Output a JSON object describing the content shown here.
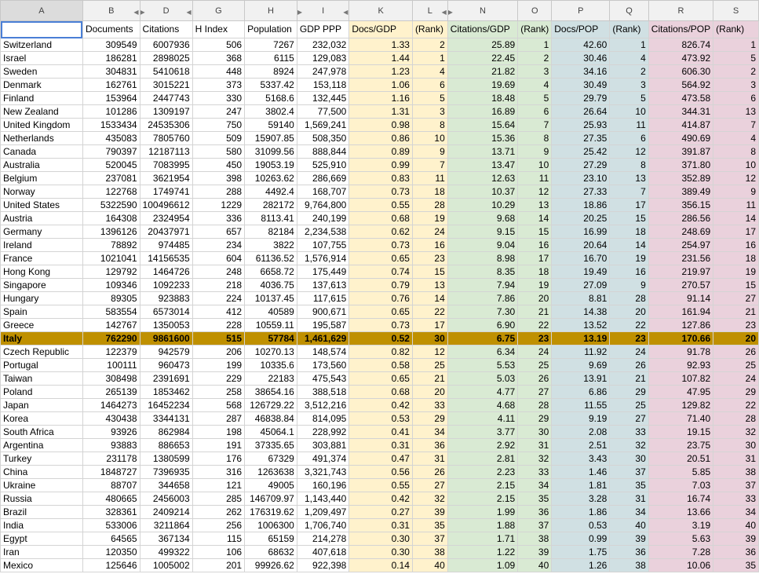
{
  "columns": [
    "A",
    "B",
    "D",
    "G",
    "H",
    "I",
    "K",
    "L",
    "N",
    "O",
    "P",
    "Q",
    "R",
    "S"
  ],
  "headers": [
    "",
    "Documents",
    "Citations",
    "H Index",
    "Population",
    "GDP PPP",
    "Docs/GDP",
    "(Rank)",
    "Citations/GDP",
    "(Rank)",
    "Docs/POP",
    "(Rank)",
    "Citations/POP",
    "(Rank)"
  ],
  "highlight_country": "Italy",
  "highlight_color": "#bf9000",
  "band_colors": {
    "docs_gdp": "#fff2cc",
    "cit_gdp": "#d9ead3",
    "docs_pop": "#d0e0e3",
    "cit_pop": "#ead1dc"
  },
  "rows": [
    [
      "Switzerland",
      "309549",
      "6007936",
      "506",
      "7267",
      "232,032",
      "1.33",
      "2",
      "25.89",
      "1",
      "42.60",
      "1",
      "826.74",
      "1"
    ],
    [
      "Israel",
      "186281",
      "2898025",
      "368",
      "6115",
      "129,083",
      "1.44",
      "1",
      "22.45",
      "2",
      "30.46",
      "4",
      "473.92",
      "5"
    ],
    [
      "Sweden",
      "304831",
      "5410618",
      "448",
      "8924",
      "247,978",
      "1.23",
      "4",
      "21.82",
      "3",
      "34.16",
      "2",
      "606.30",
      "2"
    ],
    [
      "Denmark",
      "162761",
      "3015221",
      "373",
      "5337.42",
      "153,118",
      "1.06",
      "6",
      "19.69",
      "4",
      "30.49",
      "3",
      "564.92",
      "3"
    ],
    [
      "Finland",
      "153964",
      "2447743",
      "330",
      "5168.6",
      "132,445",
      "1.16",
      "5",
      "18.48",
      "5",
      "29.79",
      "5",
      "473.58",
      "6"
    ],
    [
      "New Zealand",
      "101286",
      "1309197",
      "247",
      "3802.4",
      "77,500",
      "1.31",
      "3",
      "16.89",
      "6",
      "26.64",
      "10",
      "344.31",
      "13"
    ],
    [
      "United Kingdom",
      "1533434",
      "24535306",
      "750",
      "59140",
      "1,569,241",
      "0.98",
      "8",
      "15.64",
      "7",
      "25.93",
      "11",
      "414.87",
      "7"
    ],
    [
      "Netherlands",
      "435083",
      "7805760",
      "509",
      "15907.85",
      "508,350",
      "0.86",
      "10",
      "15.36",
      "8",
      "27.35",
      "6",
      "490.69",
      "4"
    ],
    [
      "Canada",
      "790397",
      "12187113",
      "580",
      "31099.56",
      "888,844",
      "0.89",
      "9",
      "13.71",
      "9",
      "25.42",
      "12",
      "391.87",
      "8"
    ],
    [
      "Australia",
      "520045",
      "7083995",
      "450",
      "19053.19",
      "525,910",
      "0.99",
      "7",
      "13.47",
      "10",
      "27.29",
      "8",
      "371.80",
      "10"
    ],
    [
      "Belgium",
      "237081",
      "3621954",
      "398",
      "10263.62",
      "286,669",
      "0.83",
      "11",
      "12.63",
      "11",
      "23.10",
      "13",
      "352.89",
      "12"
    ],
    [
      "Norway",
      "122768",
      "1749741",
      "288",
      "4492.4",
      "168,707",
      "0.73",
      "18",
      "10.37",
      "12",
      "27.33",
      "7",
      "389.49",
      "9"
    ],
    [
      "United States",
      "5322590",
      "100496612",
      "1229",
      "282172",
      "9,764,800",
      "0.55",
      "28",
      "10.29",
      "13",
      "18.86",
      "17",
      "356.15",
      "11"
    ],
    [
      "Austria",
      "164308",
      "2324954",
      "336",
      "8113.41",
      "240,199",
      "0.68",
      "19",
      "9.68",
      "14",
      "20.25",
      "15",
      "286.56",
      "14"
    ],
    [
      "Germany",
      "1396126",
      "20437971",
      "657",
      "82184",
      "2,234,538",
      "0.62",
      "24",
      "9.15",
      "15",
      "16.99",
      "18",
      "248.69",
      "17"
    ],
    [
      "Ireland",
      "78892",
      "974485",
      "234",
      "3822",
      "107,755",
      "0.73",
      "16",
      "9.04",
      "16",
      "20.64",
      "14",
      "254.97",
      "16"
    ],
    [
      "France",
      "1021041",
      "14156535",
      "604",
      "61136.52",
      "1,576,914",
      "0.65",
      "23",
      "8.98",
      "17",
      "16.70",
      "19",
      "231.56",
      "18"
    ],
    [
      "Hong Kong",
      "129792",
      "1464726",
      "248",
      "6658.72",
      "175,449",
      "0.74",
      "15",
      "8.35",
      "18",
      "19.49",
      "16",
      "219.97",
      "19"
    ],
    [
      "Singapore",
      "109346",
      "1092233",
      "218",
      "4036.75",
      "137,613",
      "0.79",
      "13",
      "7.94",
      "19",
      "27.09",
      "9",
      "270.57",
      "15"
    ],
    [
      "Hungary",
      "89305",
      "923883",
      "224",
      "10137.45",
      "117,615",
      "0.76",
      "14",
      "7.86",
      "20",
      "8.81",
      "28",
      "91.14",
      "27"
    ],
    [
      "Spain",
      "583554",
      "6573014",
      "412",
      "40589",
      "900,671",
      "0.65",
      "22",
      "7.30",
      "21",
      "14.38",
      "20",
      "161.94",
      "21"
    ],
    [
      "Greece",
      "142767",
      "1350053",
      "228",
      "10559.11",
      "195,587",
      "0.73",
      "17",
      "6.90",
      "22",
      "13.52",
      "22",
      "127.86",
      "23"
    ],
    [
      "Italy",
      "762290",
      "9861600",
      "515",
      "57784",
      "1,461,629",
      "0.52",
      "30",
      "6.75",
      "23",
      "13.19",
      "23",
      "170.66",
      "20"
    ],
    [
      "Czech Republic",
      "122379",
      "942579",
      "206",
      "10270.13",
      "148,574",
      "0.82",
      "12",
      "6.34",
      "24",
      "11.92",
      "24",
      "91.78",
      "26"
    ],
    [
      "Portugal",
      "100111",
      "960473",
      "199",
      "10335.6",
      "173,560",
      "0.58",
      "25",
      "5.53",
      "25",
      "9.69",
      "26",
      "92.93",
      "25"
    ],
    [
      "Taiwan",
      "308498",
      "2391691",
      "229",
      "22183",
      "475,543",
      "0.65",
      "21",
      "5.03",
      "26",
      "13.91",
      "21",
      "107.82",
      "24"
    ],
    [
      "Poland",
      "265139",
      "1853462",
      "258",
      "38654.16",
      "388,518",
      "0.68",
      "20",
      "4.77",
      "27",
      "6.86",
      "29",
      "47.95",
      "29"
    ],
    [
      "Japan",
      "1464273",
      "16452234",
      "568",
      "126729.22",
      "3,512,216",
      "0.42",
      "33",
      "4.68",
      "28",
      "11.55",
      "25",
      "129.82",
      "22"
    ],
    [
      "Korea",
      "430438",
      "3344131",
      "287",
      "46838.84",
      "814,095",
      "0.53",
      "29",
      "4.11",
      "29",
      "9.19",
      "27",
      "71.40",
      "28"
    ],
    [
      "South Africa",
      "93926",
      "862984",
      "198",
      "45064.1",
      "228,992",
      "0.41",
      "34",
      "3.77",
      "30",
      "2.08",
      "33",
      "19.15",
      "32"
    ],
    [
      "Argentina",
      "93883",
      "886653",
      "191",
      "37335.65",
      "303,881",
      "0.31",
      "36",
      "2.92",
      "31",
      "2.51",
      "32",
      "23.75",
      "30"
    ],
    [
      "Turkey",
      "231178",
      "1380599",
      "176",
      "67329",
      "491,374",
      "0.47",
      "31",
      "2.81",
      "32",
      "3.43",
      "30",
      "20.51",
      "31"
    ],
    [
      "China",
      "1848727",
      "7396935",
      "316",
      "1263638",
      "3,321,743",
      "0.56",
      "26",
      "2.23",
      "33",
      "1.46",
      "37",
      "5.85",
      "38"
    ],
    [
      "Ukraine",
      "88707",
      "344658",
      "121",
      "49005",
      "160,196",
      "0.55",
      "27",
      "2.15",
      "34",
      "1.81",
      "35",
      "7.03",
      "37"
    ],
    [
      "Russia",
      "480665",
      "2456003",
      "285",
      "146709.97",
      "1,143,440",
      "0.42",
      "32",
      "2.15",
      "35",
      "3.28",
      "31",
      "16.74",
      "33"
    ],
    [
      "Brazil",
      "328361",
      "2409214",
      "262",
      "176319.62",
      "1,209,497",
      "0.27",
      "39",
      "1.99",
      "36",
      "1.86",
      "34",
      "13.66",
      "34"
    ],
    [
      "India",
      "533006",
      "3211864",
      "256",
      "1006300",
      "1,706,740",
      "0.31",
      "35",
      "1.88",
      "37",
      "0.53",
      "40",
      "3.19",
      "40"
    ],
    [
      "Egypt",
      "64565",
      "367134",
      "115",
      "65159",
      "214,278",
      "0.30",
      "37",
      "1.71",
      "38",
      "0.99",
      "39",
      "5.63",
      "39"
    ],
    [
      "Iran",
      "120350",
      "499322",
      "106",
      "68632",
      "407,618",
      "0.30",
      "38",
      "1.22",
      "39",
      "1.75",
      "36",
      "7.28",
      "36"
    ],
    [
      "Mexico",
      "125646",
      "1005002",
      "201",
      "99926.62",
      "922,398",
      "0.14",
      "40",
      "1.09",
      "40",
      "1.26",
      "38",
      "10.06",
      "35"
    ]
  ]
}
